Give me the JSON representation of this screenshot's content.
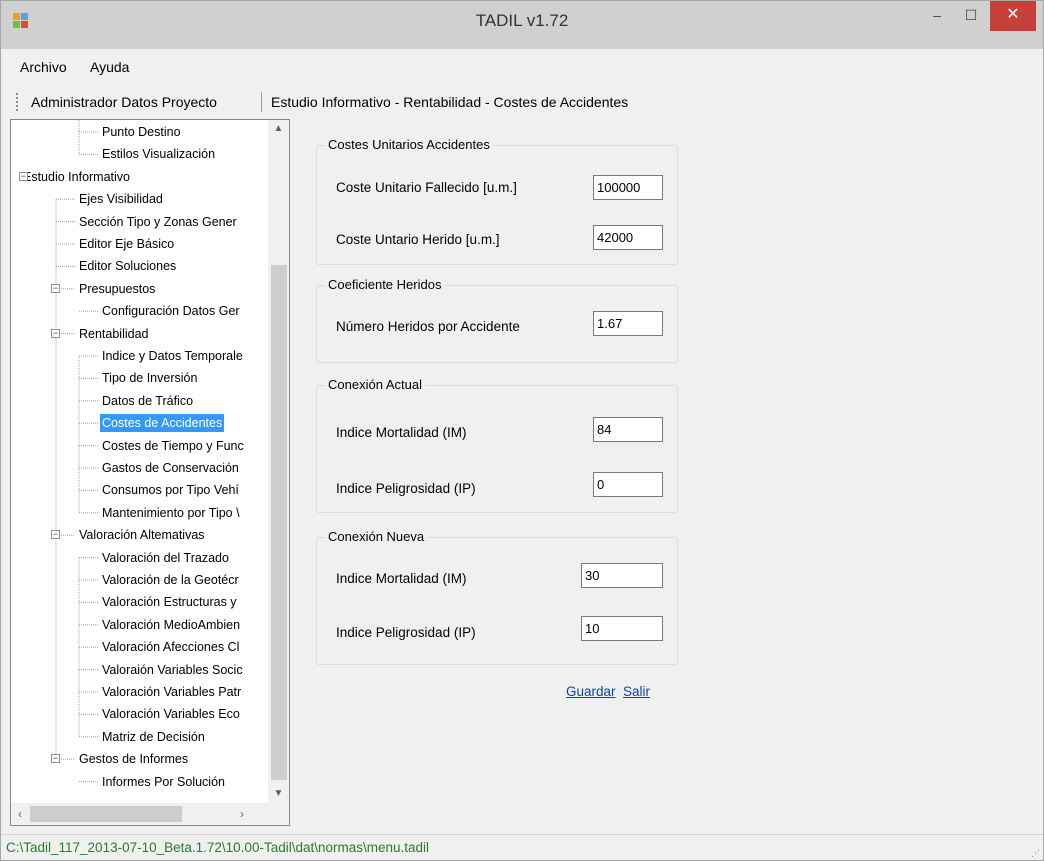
{
  "window": {
    "title": "TADIL v1.72",
    "minimize_glyph": "–",
    "maximize_glyph": "☐",
    "close_glyph": "✕"
  },
  "menu": [
    "Archivo",
    "Ayuda"
  ],
  "breadcrumb": {
    "left": "Administrador Datos Proyecto",
    "right": "Estudio Informativo - Rentabilidad - Costes de Accidentes"
  },
  "tree": [
    {
      "label": "Punto Destino",
      "depth": 2
    },
    {
      "label": "Estilos Visualización",
      "depth": 2
    },
    {
      "label": "Estudio Informativo",
      "depth": 0,
      "expander": "−"
    },
    {
      "label": "Ejes Visibilidad",
      "depth": 1
    },
    {
      "label": "Sección Tipo y Zonas Gener",
      "depth": 1
    },
    {
      "label": "Editor Eje Básico",
      "depth": 1
    },
    {
      "label": "Editor Soluciones",
      "depth": 1
    },
    {
      "label": "Presupuestos",
      "depth": 1,
      "expander": "−"
    },
    {
      "label": "Configuración Datos Ger",
      "depth": 2
    },
    {
      "label": "Rentabilidad",
      "depth": 1,
      "expander": "−"
    },
    {
      "label": "Indice y Datos Temporale",
      "depth": 2
    },
    {
      "label": "Tipo de Inversión",
      "depth": 2
    },
    {
      "label": "Datos de Tráfico",
      "depth": 2
    },
    {
      "label": "Costes de Accidentes",
      "depth": 2,
      "selected": true
    },
    {
      "label": "Costes de Tiempo y Func",
      "depth": 2
    },
    {
      "label": "Gastos de Conservación",
      "depth": 2
    },
    {
      "label": "Consumos por Tipo Vehí",
      "depth": 2
    },
    {
      "label": "Mantenimiento por Tipo \\",
      "depth": 2
    },
    {
      "label": "Valoración Altemativas",
      "depth": 1,
      "expander": "−"
    },
    {
      "label": "Valoración del Trazado",
      "depth": 2
    },
    {
      "label": "Valoración de la Geotécr",
      "depth": 2
    },
    {
      "label": "Valoración Estructuras y",
      "depth": 2
    },
    {
      "label": "Valoración MedioAmbien",
      "depth": 2
    },
    {
      "label": "Valoración Afecciones Cl",
      "depth": 2
    },
    {
      "label": "Valoraión Variables Socic",
      "depth": 2
    },
    {
      "label": "Valoración Variables Patr",
      "depth": 2
    },
    {
      "label": "Valoración Variables Eco",
      "depth": 2
    },
    {
      "label": "Matriz de Decisión",
      "depth": 2
    },
    {
      "label": "Gestos de Informes",
      "depth": 1,
      "expander": "−"
    },
    {
      "label": "Informes Por Solución",
      "depth": 2
    }
  ],
  "scroll_glyphs": {
    "up": "▲",
    "down": "▼",
    "left": "‹",
    "right": "›"
  },
  "form": {
    "costes": {
      "legend": "Costes Unitarios Accidentes",
      "fallecido_label": "Coste Unitario Fallecido [u.m.]",
      "fallecido_value": "100000",
      "herido_label": "Coste Untario Herido [u.m.]",
      "herido_value": "42000"
    },
    "coeficiente": {
      "legend": "Coeficiente Heridos",
      "heridos_label": "Número Heridos por Accidente",
      "heridos_value": "1.67"
    },
    "actual": {
      "legend": "Conexión Actual",
      "im_label": "Indice Mortalidad (IM)",
      "im_value": "84",
      "ip_label": "Indice Peligrosidad (IP)",
      "ip_value": "0"
    },
    "nueva": {
      "legend": "Conexión Nueva",
      "im_label": "Indice Mortalidad (IM)",
      "im_value": "30",
      "ip_label": "Indice Peligrosidad (IP)",
      "ip_value": "10"
    }
  },
  "actions": {
    "guardar": "Guardar",
    "salir": "Salir"
  },
  "status": {
    "path": "C:\\Tadil_117_2013-07-10_Beta.1.72\\10.00-Tadil\\dat\\normas\\menu.tadil"
  },
  "colors": {
    "selection": "#3399ff",
    "link": "#0645ad",
    "status_text": "#2d7a2d",
    "close_button": "#c7413a"
  }
}
